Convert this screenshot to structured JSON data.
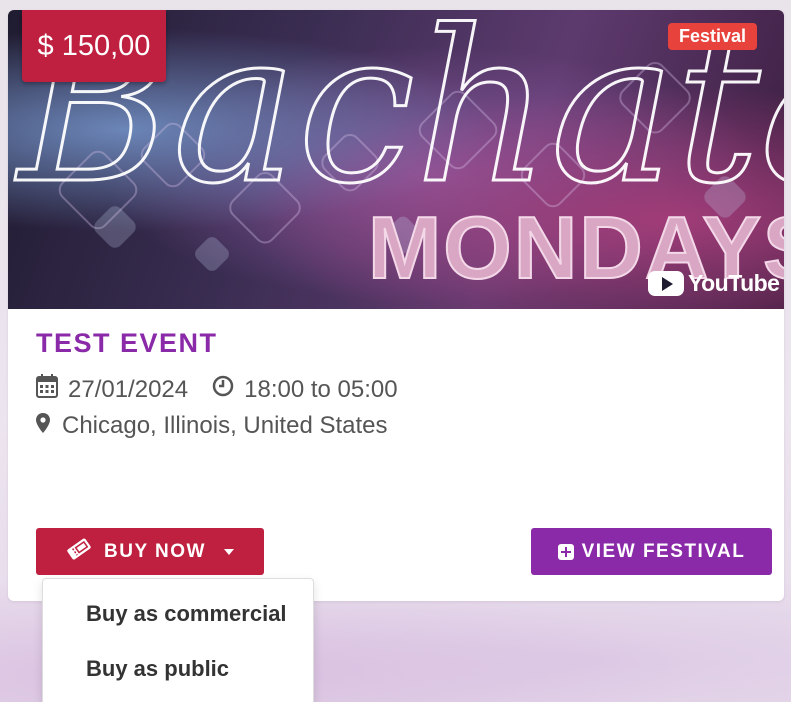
{
  "event": {
    "price": "$ 150,00",
    "category": "Festival",
    "banner_script": "Bachata",
    "banner_word": "MONDAYS",
    "banner_watermark": "YouTube",
    "title": "TEST EVENT",
    "date": "27/01/2024",
    "time": "18:00 to 05:00",
    "location": "Chicago, Illinois, United States"
  },
  "actions": {
    "buy_label": "BUY NOW",
    "view_label": "VIEW FESTIVAL"
  },
  "buy_menu": {
    "items": [
      {
        "label": "Buy as commercial"
      },
      {
        "label": "Buy as public"
      }
    ]
  },
  "icons": {
    "calendar": "calendar-icon",
    "clock": "clock-icon",
    "location": "map-marker-icon",
    "ticket": "ticket-icon",
    "plus": "plus-square-icon",
    "caret": "caret-down-icon"
  },
  "colors": {
    "primary_red": "#c0203f",
    "primary_purple": "#8b2aa8",
    "badge_red": "#e8423c"
  }
}
